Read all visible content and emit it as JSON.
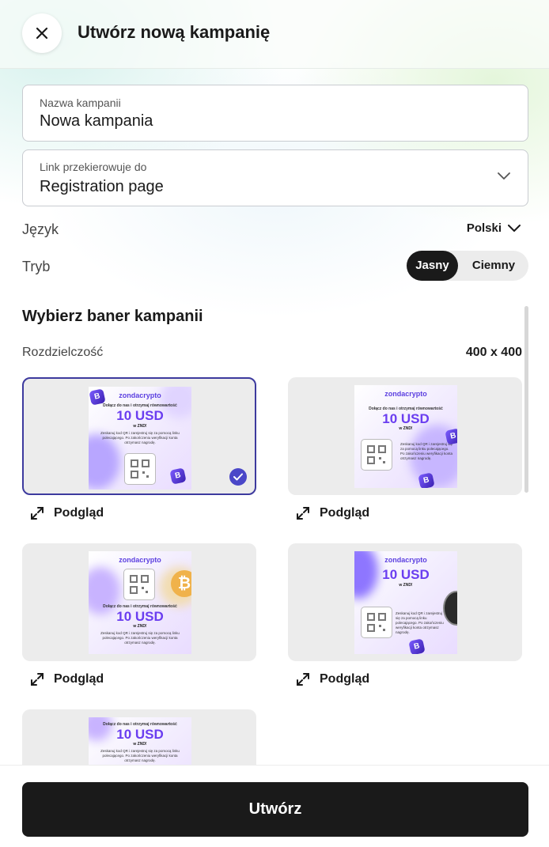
{
  "header": {
    "title": "Utwórz nową kampanię",
    "close_icon": "close-icon"
  },
  "form": {
    "name": {
      "label": "Nazwa kampanii",
      "value": "Nowa kampania"
    },
    "redirect": {
      "label": "Link przekierowuje do",
      "value": "Registration page"
    },
    "language": {
      "label": "Język",
      "value": "Polski"
    },
    "mode": {
      "label": "Tryb",
      "options": [
        "Jasny",
        "Ciemny"
      ],
      "selected": "Jasny"
    }
  },
  "banners": {
    "title": "Wybierz baner kampanii",
    "resolution_label": "Rozdzielczość",
    "resolution_value": "400 x 400",
    "preview_label": "Podgląd",
    "accent": "#3d3a9e",
    "content": {
      "logo": "zondacrypto",
      "tagline": "Dołącz do nas i otrzymaj równowartość",
      "amount": "10 USD",
      "sub": "w ZND!",
      "description": "Zeskanuj kod QR i zarejestruj się za pomocą linku polecającego. Po zakończeniu weryfikacji konta otrzymasz nagrodę."
    },
    "selected_index": 0
  },
  "footer": {
    "create_label": "Utwórz",
    "button_color": "#1a1a1a"
  }
}
